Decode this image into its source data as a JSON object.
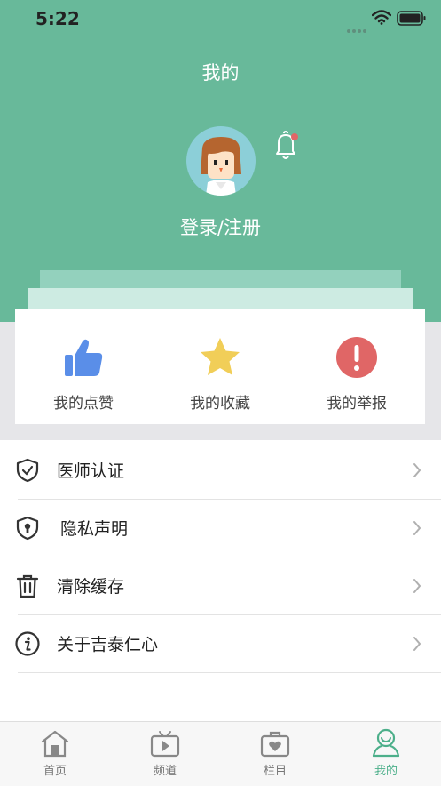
{
  "status_bar": {
    "time": "5:22"
  },
  "header": {
    "title": "我的",
    "login_label": "登录/注册"
  },
  "quick_actions": [
    {
      "label": "我的点赞",
      "icon": "thumbs-up-icon",
      "color": "#5a8ee8"
    },
    {
      "label": "我的收藏",
      "icon": "star-icon",
      "color": "#f1ce58"
    },
    {
      "label": "我的举报",
      "icon": "exclamation-icon",
      "color": "#e06666"
    }
  ],
  "menu": [
    {
      "label": "医师认证",
      "icon": "shield-check-icon"
    },
    {
      "label": "隐私声明",
      "icon": "shield-lock-icon"
    },
    {
      "label": "清除缓存",
      "icon": "trash-icon"
    },
    {
      "label": "关于吉泰仁心",
      "icon": "info-icon"
    }
  ],
  "tabs": [
    {
      "label": "首页",
      "icon": "home-icon",
      "active": false
    },
    {
      "label": "频道",
      "icon": "tv-icon",
      "active": false
    },
    {
      "label": "栏目",
      "icon": "heart-bag-icon",
      "active": false
    },
    {
      "label": "我的",
      "icon": "person-icon",
      "active": true
    }
  ],
  "colors": {
    "header": "#68b99a",
    "accent": "#4caf8a",
    "notification_dot": "#e06666"
  }
}
